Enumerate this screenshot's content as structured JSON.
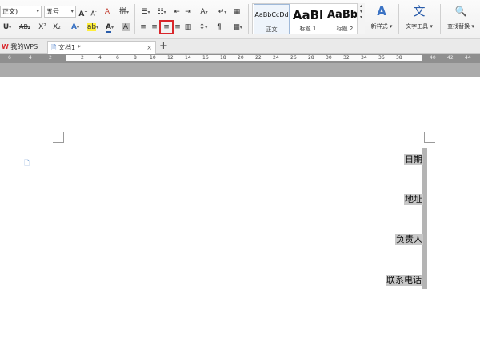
{
  "ribbon": {
    "font_name": "正文)",
    "font_size": "五号",
    "font_grow": "A",
    "font_shrink": "A",
    "clear_format": "A",
    "phonetic": "拼",
    "underline": "U",
    "strikethrough": "AB",
    "superscript": "X²",
    "subscript": "X₂",
    "text_effect": "A",
    "highlight_color": "ab",
    "font_color": "A",
    "char_shading": "A",
    "bullets": "☰",
    "numbering": "☷",
    "decrease_indent": "⇤",
    "increase_indent": "⇥",
    "chinese_layout": "A",
    "show_marks": "↵",
    "sort": "↕",
    "table_grid": "▦",
    "align_left": "≡",
    "align_center": "≡",
    "align_right": "≡",
    "justify": "≡",
    "distribute": "▥",
    "line_spacing": "↕",
    "para_settings": "¶",
    "borders": "▦",
    "styles": [
      {
        "sample": "AaBbCcDd",
        "name": "正文"
      },
      {
        "sample": "AaBl",
        "name": "标题 1"
      },
      {
        "sample": "AaBb(",
        "name": "标题 2"
      }
    ],
    "new_style": {
      "icon": "A",
      "label": "新样式 ▾"
    },
    "text_tools": {
      "icon": "文",
      "label": "文字工具 ▾"
    },
    "find_replace": {
      "icon": "🔍",
      "label": "查找替换 ▾"
    }
  },
  "tabs": {
    "wps_logo": "W",
    "wps_label": "我的WPS",
    "doc_icon": "🗎",
    "doc_label": "文档1 *",
    "close": "×",
    "add": "+"
  },
  "ruler": {
    "left_numbers": [
      "6",
      "4",
      "2"
    ],
    "right_numbers": [
      "2",
      "4",
      "6",
      "8",
      "10",
      "12",
      "14",
      "16",
      "18",
      "20",
      "22",
      "24",
      "26",
      "28",
      "30",
      "32",
      "34",
      "36",
      "38"
    ],
    "tail_numbers": [
      "40",
      "42",
      "44"
    ]
  },
  "document": {
    "paragraph_mark": "🗋",
    "labels": [
      "日期",
      "地址",
      "负责人",
      "联系电话"
    ]
  }
}
